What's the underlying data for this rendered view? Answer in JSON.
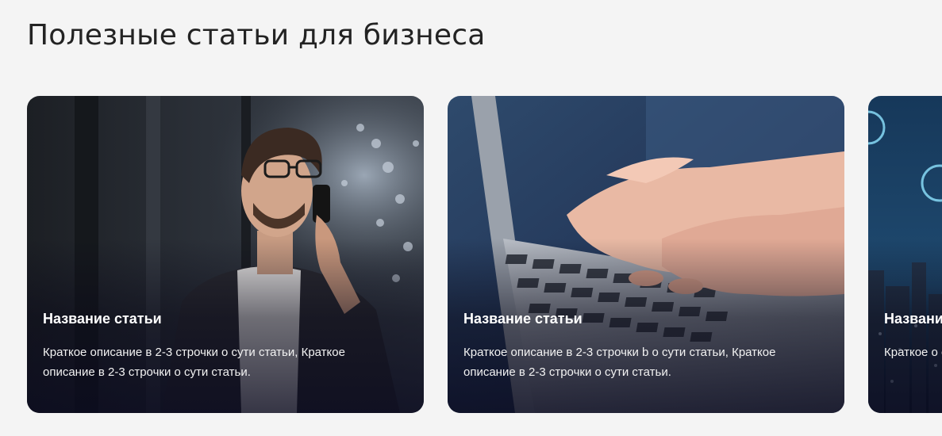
{
  "section": {
    "title": "Полезные статьи для бизнеса"
  },
  "cards": [
    {
      "title": "Название статьи",
      "description": "Краткое описание в 2-3 строчки о сути статьи, Краткое описание в 2-3 строчки о сути статьи.",
      "image": "businessman-on-phone"
    },
    {
      "title": "Название статьи",
      "description": "Краткое описание в 2-3 строчки b о сути статьи, Краткое описание в 2-3 строчки о сути статьи.",
      "image": "hands-typing-on-laptop"
    },
    {
      "title": "Названи",
      "description": "Краткое о описание",
      "image": "city-network-lights"
    }
  ]
}
